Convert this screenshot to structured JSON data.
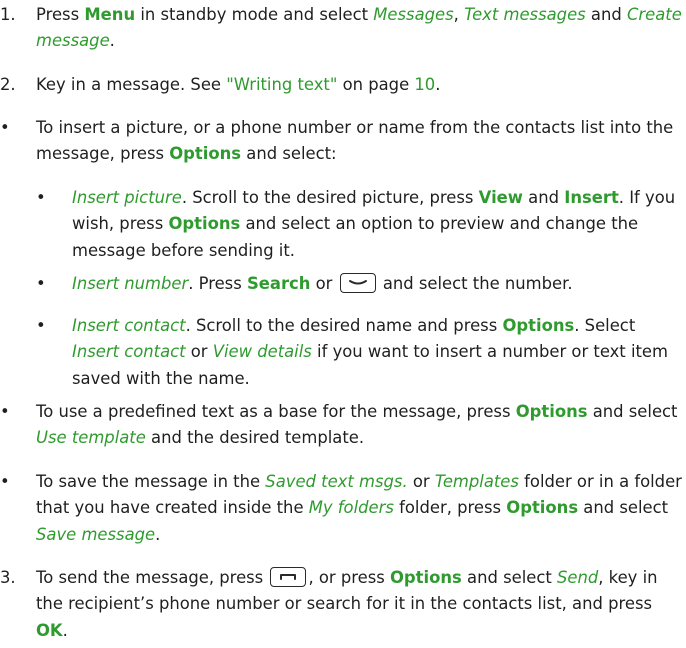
{
  "step1": {
    "num": "1.",
    "t0": "Press ",
    "menu": "Menu",
    "t1": " in standby mode and select ",
    "messages": "Messages",
    "t2": ", ",
    "text_messages": "Text messages",
    "t3": " and ",
    "create_message": "Create message",
    "t4": "."
  },
  "step2": {
    "num": "2.",
    "t0": "Key in a message. See ",
    "link": "\"Writing text\"",
    "t1": " on page ",
    "page": "10",
    "t2": "."
  },
  "bullet_insert": {
    "bullet": "•",
    "t0": "To insert a picture, or a phone number or name from the contacts list into the message, press ",
    "options": "Options",
    "t1": " and select:"
  },
  "sub_picture": {
    "bullet": "•",
    "label": "Insert picture",
    "t0": ". Scroll to the desired picture, press ",
    "view": "View",
    "t1": " and ",
    "insert": "Insert",
    "t2": ". If you wish, press ",
    "options": "Options",
    "t3": " and select an option to preview and change the message before sending it."
  },
  "sub_number": {
    "bullet": "•",
    "label": "Insert number",
    "t0": ". Press ",
    "search": "Search",
    "t1": " or ",
    "key_icon": "end-call-key-icon",
    "t2": " and select the number."
  },
  "sub_contact": {
    "bullet": "•",
    "label": "Insert contact",
    "t0": ". Scroll to the desired name and press ",
    "options": "Options",
    "t1": ". Select ",
    "insert_contact": "Insert contact",
    "t2": " or ",
    "view_details": "View details",
    "t3": " if you want to insert a number or text item saved with the name."
  },
  "bullet_template": {
    "bullet": "•",
    "t0": "To use a predefined text as a base for the message, press ",
    "options": "Options",
    "t1": " and select ",
    "use_template": "Use template",
    "t2": " and the desired template."
  },
  "bullet_save": {
    "bullet": "•",
    "t0": "To save the message in the ",
    "saved": "Saved text msgs.",
    "t1": " or ",
    "templates": "Templates",
    "t2": " folder or in a folder that you have created inside the ",
    "my_folders": "My folders",
    "t3": " folder, press ",
    "options": "Options",
    "t4": " and select ",
    "save_message": "Save message",
    "t5": "."
  },
  "step3": {
    "num": "3.",
    "t0": "To send the message, press ",
    "key_icon": "call-key-icon",
    "t1": ", or press ",
    "options": "Options",
    "t2": " and select ",
    "send": "Send",
    "t3": ", key in the recipient’s phone number or search for it in the contacts list, and press ",
    "ok": "OK",
    "t4": "."
  },
  "colors": {
    "accent_green": "#2f9b2f",
    "text": "#1f1f1f"
  }
}
